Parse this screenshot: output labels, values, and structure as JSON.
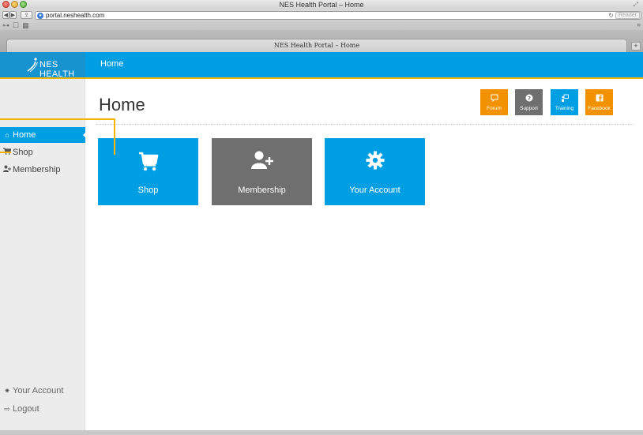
{
  "browser": {
    "window_title": "NES Health Portal – Home",
    "url": "portal.neshealth.com",
    "reader_label": "Reader",
    "tab_title": "NES Health Portal – Home"
  },
  "app": {
    "logo_text": "NES HEALTH",
    "header_title": "Home",
    "accent_color": "#009fe3",
    "highlight_color": "#f7b500"
  },
  "sidebar": {
    "items": [
      {
        "label": "Home",
        "icon": "home-icon",
        "active": true
      },
      {
        "label": "Shop",
        "icon": "cart-icon",
        "active": false
      },
      {
        "label": "Membership",
        "icon": "add-user-icon",
        "active": false
      }
    ],
    "bottom_items": [
      {
        "label": "Your Account",
        "icon": "gear-icon"
      },
      {
        "label": "Logout",
        "icon": "logout-icon"
      }
    ]
  },
  "main": {
    "page_title": "Home",
    "social_buttons": [
      {
        "label": "Forum",
        "icon": "chat-bubble-icon",
        "color": "#f39200"
      },
      {
        "label": "Support",
        "icon": "question-icon",
        "color": "#6f6f6f"
      },
      {
        "label": "Training",
        "icon": "presentation-icon",
        "color": "#009fe3"
      },
      {
        "label": "Facebook",
        "icon": "facebook-icon",
        "color": "#f39200"
      }
    ],
    "tiles": [
      {
        "label": "Shop",
        "icon": "cart-icon",
        "color": "#009fe3"
      },
      {
        "label": "Membership",
        "icon": "add-user-icon",
        "color": "#6f6f6f"
      },
      {
        "label": "Your Account",
        "icon": "gear-icon",
        "color": "#009fe3"
      }
    ]
  }
}
